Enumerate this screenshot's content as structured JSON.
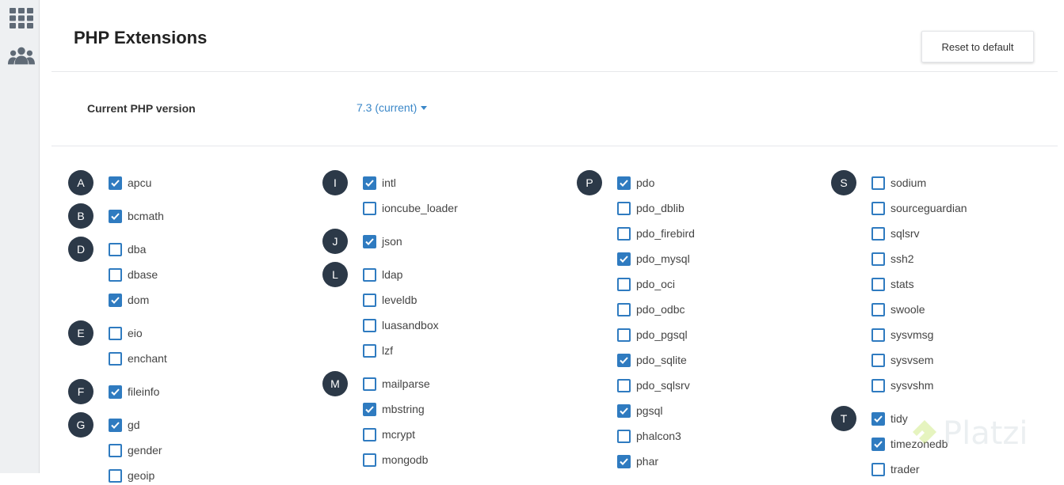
{
  "page": {
    "title": "PHP Extensions",
    "reset_label": "Reset to default",
    "version_label": "Current PHP version",
    "version_value": "7.3 (current)"
  },
  "sidebar": {
    "icons": [
      "apps-grid-icon",
      "users-icon"
    ]
  },
  "watermark": "Platzi",
  "columns": [
    {
      "groups": [
        {
          "letter": "A",
          "items": [
            {
              "name": "apcu",
              "checked": true
            }
          ]
        },
        {
          "letter": "B",
          "items": [
            {
              "name": "bcmath",
              "checked": true
            }
          ]
        },
        {
          "letter": "D",
          "items": [
            {
              "name": "dba",
              "checked": false
            },
            {
              "name": "dbase",
              "checked": false
            },
            {
              "name": "dom",
              "checked": true
            }
          ]
        },
        {
          "letter": "E",
          "items": [
            {
              "name": "eio",
              "checked": false
            },
            {
              "name": "enchant",
              "checked": false
            }
          ]
        },
        {
          "letter": "F",
          "items": [
            {
              "name": "fileinfo",
              "checked": true
            }
          ]
        },
        {
          "letter": "G",
          "items": [
            {
              "name": "gd",
              "checked": true
            },
            {
              "name": "gender",
              "checked": false
            },
            {
              "name": "geoip",
              "checked": false
            }
          ]
        }
      ]
    },
    {
      "groups": [
        {
          "letter": "I",
          "items": [
            {
              "name": "intl",
              "checked": true
            },
            {
              "name": "ioncube_loader",
              "checked": false
            }
          ]
        },
        {
          "letter": "J",
          "items": [
            {
              "name": "json",
              "checked": true
            }
          ]
        },
        {
          "letter": "L",
          "items": [
            {
              "name": "ldap",
              "checked": false
            },
            {
              "name": "leveldb",
              "checked": false
            },
            {
              "name": "luasandbox",
              "checked": false
            },
            {
              "name": "lzf",
              "checked": false
            }
          ]
        },
        {
          "letter": "M",
          "items": [
            {
              "name": "mailparse",
              "checked": false
            },
            {
              "name": "mbstring",
              "checked": true
            },
            {
              "name": "mcrypt",
              "checked": false
            },
            {
              "name": "mongodb",
              "checked": false
            }
          ]
        }
      ]
    },
    {
      "groups": [
        {
          "letter": "P",
          "items": [
            {
              "name": "pdo",
              "checked": true
            },
            {
              "name": "pdo_dblib",
              "checked": false
            },
            {
              "name": "pdo_firebird",
              "checked": false
            },
            {
              "name": "pdo_mysql",
              "checked": true
            },
            {
              "name": "pdo_oci",
              "checked": false
            },
            {
              "name": "pdo_odbc",
              "checked": false
            },
            {
              "name": "pdo_pgsql",
              "checked": false
            },
            {
              "name": "pdo_sqlite",
              "checked": true
            },
            {
              "name": "pdo_sqlsrv",
              "checked": false
            },
            {
              "name": "pgsql",
              "checked": true
            },
            {
              "name": "phalcon3",
              "checked": false
            },
            {
              "name": "phar",
              "checked": true
            }
          ]
        }
      ]
    },
    {
      "groups": [
        {
          "letter": "S",
          "items": [
            {
              "name": "sodium",
              "checked": false
            },
            {
              "name": "sourceguardian",
              "checked": false
            },
            {
              "name": "sqlsrv",
              "checked": false
            },
            {
              "name": "ssh2",
              "checked": false
            },
            {
              "name": "stats",
              "checked": false
            },
            {
              "name": "swoole",
              "checked": false
            },
            {
              "name": "sysvmsg",
              "checked": false
            },
            {
              "name": "sysvsem",
              "checked": false
            },
            {
              "name": "sysvshm",
              "checked": false
            }
          ]
        },
        {
          "letter": "T",
          "items": [
            {
              "name": "tidy",
              "checked": true
            },
            {
              "name": "timezonedb",
              "checked": true
            },
            {
              "name": "trader",
              "checked": false
            }
          ]
        }
      ]
    }
  ]
}
